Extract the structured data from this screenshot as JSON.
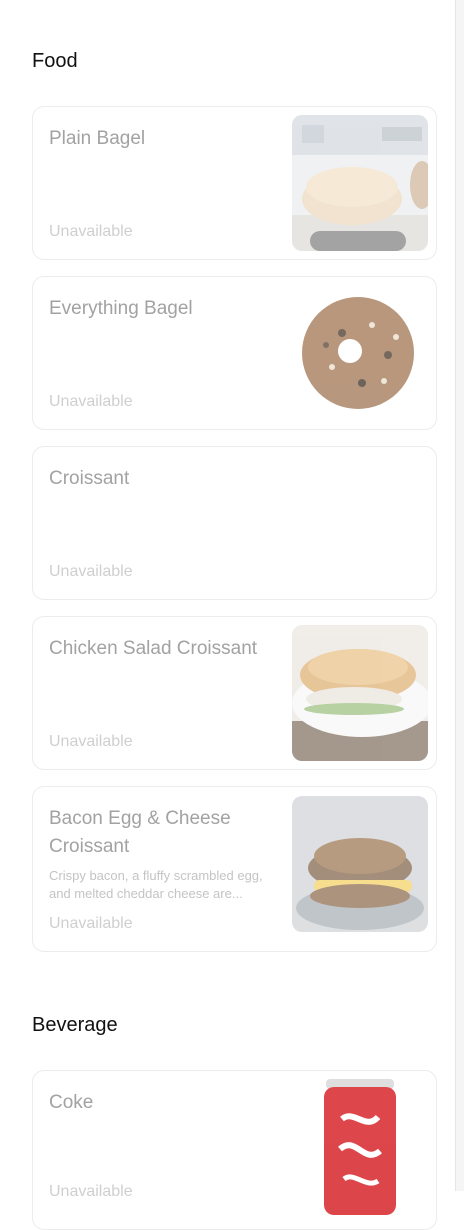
{
  "sections": [
    {
      "title": "Food",
      "items": [
        {
          "name": "Plain Bagel",
          "description": "",
          "status": "Unavailable",
          "image": "plain-bagel-photo"
        },
        {
          "name": "Everything Bagel",
          "description": "",
          "status": "Unavailable",
          "image": "everything-bagel-photo"
        },
        {
          "name": "Croissant",
          "description": "",
          "status": "Unavailable",
          "image": ""
        },
        {
          "name": "Chicken Salad Croissant",
          "description": "",
          "status": "Unavailable",
          "image": "chicken-salad-croissant-photo"
        },
        {
          "name": "Bacon Egg & Cheese Croissant",
          "description": "Crispy bacon, a fluffy scrambled egg, and melted cheddar cheese are...",
          "status": "Unavailable",
          "image": "bacon-egg-cheese-croissant-photo"
        }
      ]
    },
    {
      "title": "Beverage",
      "items": [
        {
          "name": "Coke",
          "description": "",
          "status": "Unavailable",
          "image": "coke-can-photo"
        }
      ]
    }
  ]
}
